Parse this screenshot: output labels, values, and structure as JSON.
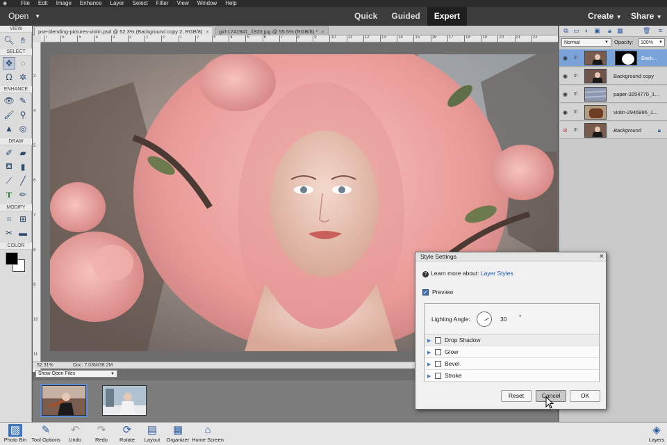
{
  "menubar": {
    "items": [
      "File",
      "Edit",
      "Image",
      "Enhance",
      "Layer",
      "Select",
      "Filter",
      "View",
      "Window",
      "Help"
    ]
  },
  "topbar": {
    "open_label": "Open",
    "modes": [
      "Quick",
      "Guided",
      "Expert"
    ],
    "active_mode": "Expert",
    "create_label": "Create",
    "share_label": "Share"
  },
  "toolbox": {
    "sections": [
      "VIEW",
      "SELECT",
      "ENHANCE",
      "DRAW",
      "MODIFY",
      "COLOR"
    ],
    "foreground_color": "#000000",
    "background_color": "#ffffff"
  },
  "document_tabs": [
    {
      "label": "pse-blending-pictures-violin.psd @ 52.3% (Background copy 2, RGB/8)",
      "active": true
    },
    {
      "label": "girl-1741941_1920.jpg @ 55.5% (RGB/8) *",
      "active": false
    }
  ],
  "rulers": {
    "horizontal": [
      "7",
      "6",
      "5",
      "4",
      "3",
      "2",
      "1",
      "0",
      "1",
      "2",
      "3",
      "4",
      "5",
      "6",
      "7",
      "8",
      "9",
      "10",
      "11",
      "12",
      "13",
      "14",
      "15",
      "16",
      "17",
      "18",
      "19",
      "20",
      "21",
      "22"
    ],
    "vertical": [
      "3",
      "4",
      "5",
      "6",
      "7",
      "8",
      "9",
      "10",
      "11"
    ]
  },
  "statusbar": {
    "zoom": "52.31%",
    "doc": "Doc: 7.03M/38.2M"
  },
  "photobin": {
    "show_label": "Show Open Files"
  },
  "layers_panel": {
    "blend_mode": "Normal",
    "opacity_label": "Opacity:",
    "opacity_value": "100%",
    "layers": [
      {
        "name": "Back...",
        "selected": true
      },
      {
        "name": "Background copy",
        "selected": false
      },
      {
        "name": "paper-3254770_1...",
        "selected": false
      },
      {
        "name": "violin-2946996_1...",
        "selected": false
      },
      {
        "name": "Background",
        "selected": false
      }
    ]
  },
  "bottombar": {
    "items": [
      "Photo Bin",
      "Tool Options",
      "Undo",
      "Redo",
      "Rotate",
      "Layout",
      "Organizer",
      "Home Screen"
    ],
    "layers_label": "Layers"
  },
  "dialog": {
    "title": "Style Settings",
    "close_glyph": "×",
    "learn_prefix": "Learn more about:",
    "learn_link": "Layer Styles",
    "preview_label": "Preview",
    "preview_checked": true,
    "lighting_label": "Lighting Angle:",
    "lighting_value": "30",
    "lighting_unit": "°",
    "styles": [
      "Drop Shadow",
      "Glow",
      "Bevel",
      "Stroke"
    ],
    "reset_label": "Reset",
    "cancel_label": "Cancel",
    "ok_label": "OK"
  }
}
